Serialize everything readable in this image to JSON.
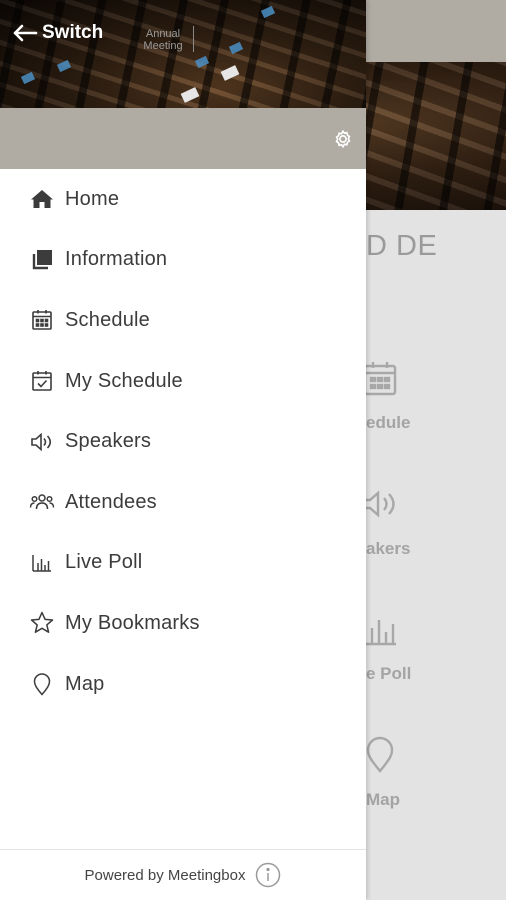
{
  "header": {
    "back_label": "Switch",
    "event_title": "Annual Meeting"
  },
  "settings": {
    "icon": "gear-icon"
  },
  "menu": {
    "items": [
      {
        "label": "Home",
        "icon": "home-icon"
      },
      {
        "label": "Information",
        "icon": "information-icon"
      },
      {
        "label": "Schedule",
        "icon": "calendar-icon"
      },
      {
        "label": "My Schedule",
        "icon": "calendar-check-icon"
      },
      {
        "label": "Speakers",
        "icon": "speaker-icon"
      },
      {
        "label": "Attendees",
        "icon": "people-icon"
      },
      {
        "label": "Live Poll",
        "icon": "bar-chart-icon"
      },
      {
        "label": "My Bookmarks",
        "icon": "star-icon"
      },
      {
        "label": "Map",
        "icon": "map-pin-icon"
      }
    ]
  },
  "footer": {
    "powered_by": "Powered by Meetingbox",
    "icon": "info-icon"
  },
  "background": {
    "heading_fragment": "D DE",
    "tiles": [
      {
        "label": "edule",
        "icon": "calendar-icon"
      },
      {
        "label": "akers",
        "icon": "speaker-icon"
      },
      {
        "label": "e Poll",
        "icon": "bar-chart-icon"
      },
      {
        "label": "Map",
        "icon": "map-pin-icon"
      }
    ]
  },
  "colors": {
    "bar_gray": "#b0aca4",
    "drawer_bg": "#ffffff",
    "text": "#3c3c3c",
    "background_gray": "#e3e3e3"
  }
}
